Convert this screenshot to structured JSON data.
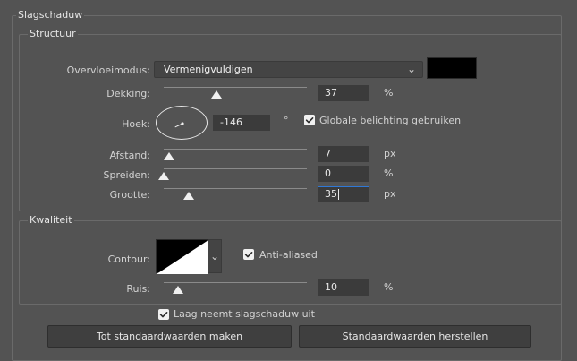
{
  "dialog": {
    "main_group": "Slagschaduw",
    "structure_group": "Structuur",
    "quality_group": "Kwaliteit"
  },
  "structure": {
    "blend_mode_label": "Overvloeimodus:",
    "blend_mode_value": "Vermenigvuldigen",
    "shadow_color": "#000000",
    "opacity_label": "Dekking:",
    "opacity_value": "37",
    "opacity_unit": "%",
    "angle_label": "Hoek:",
    "angle_value": "-146",
    "angle_unit": "°",
    "global_light_label": "Globale belichting gebruiken",
    "global_light_checked": true,
    "distance_label": "Afstand:",
    "distance_value": "7",
    "distance_unit": "px",
    "spread_label": "Spreiden:",
    "spread_value": "0",
    "spread_unit": "%",
    "size_label": "Grootte:",
    "size_value": "35",
    "size_unit": "px"
  },
  "quality": {
    "contour_label": "Contour:",
    "anti_aliased_label": "Anti-aliased",
    "anti_aliased_checked": true,
    "noise_label": "Ruis:",
    "noise_value": "10",
    "noise_unit": "%"
  },
  "footer": {
    "layer_knocks_out_label": "Laag neemt slagschaduw uit",
    "layer_knocks_out_checked": true,
    "make_default_button": "Tot standaardwaarden maken",
    "reset_default_button": "Standaardwaarden herstellen"
  },
  "icons": {
    "dropdown_chevron": "chevron-down-icon",
    "checkbox": "checkbox-checked-icon",
    "angle_dial": "angle-dial-icon",
    "contour_preview": "contour-preview-icon"
  },
  "colors": {
    "panel_bg": "#535353",
    "field_bg": "#3b3b3b",
    "accent_focus": "#2f78d6",
    "text": "#d6d6d6"
  },
  "levels": {
    "opacity_fraction": 0.37,
    "distance_fraction": 0.035,
    "spread_fraction": 0.0,
    "size_fraction": 0.175,
    "noise_fraction": 0.1,
    "angle_degrees": -146
  }
}
